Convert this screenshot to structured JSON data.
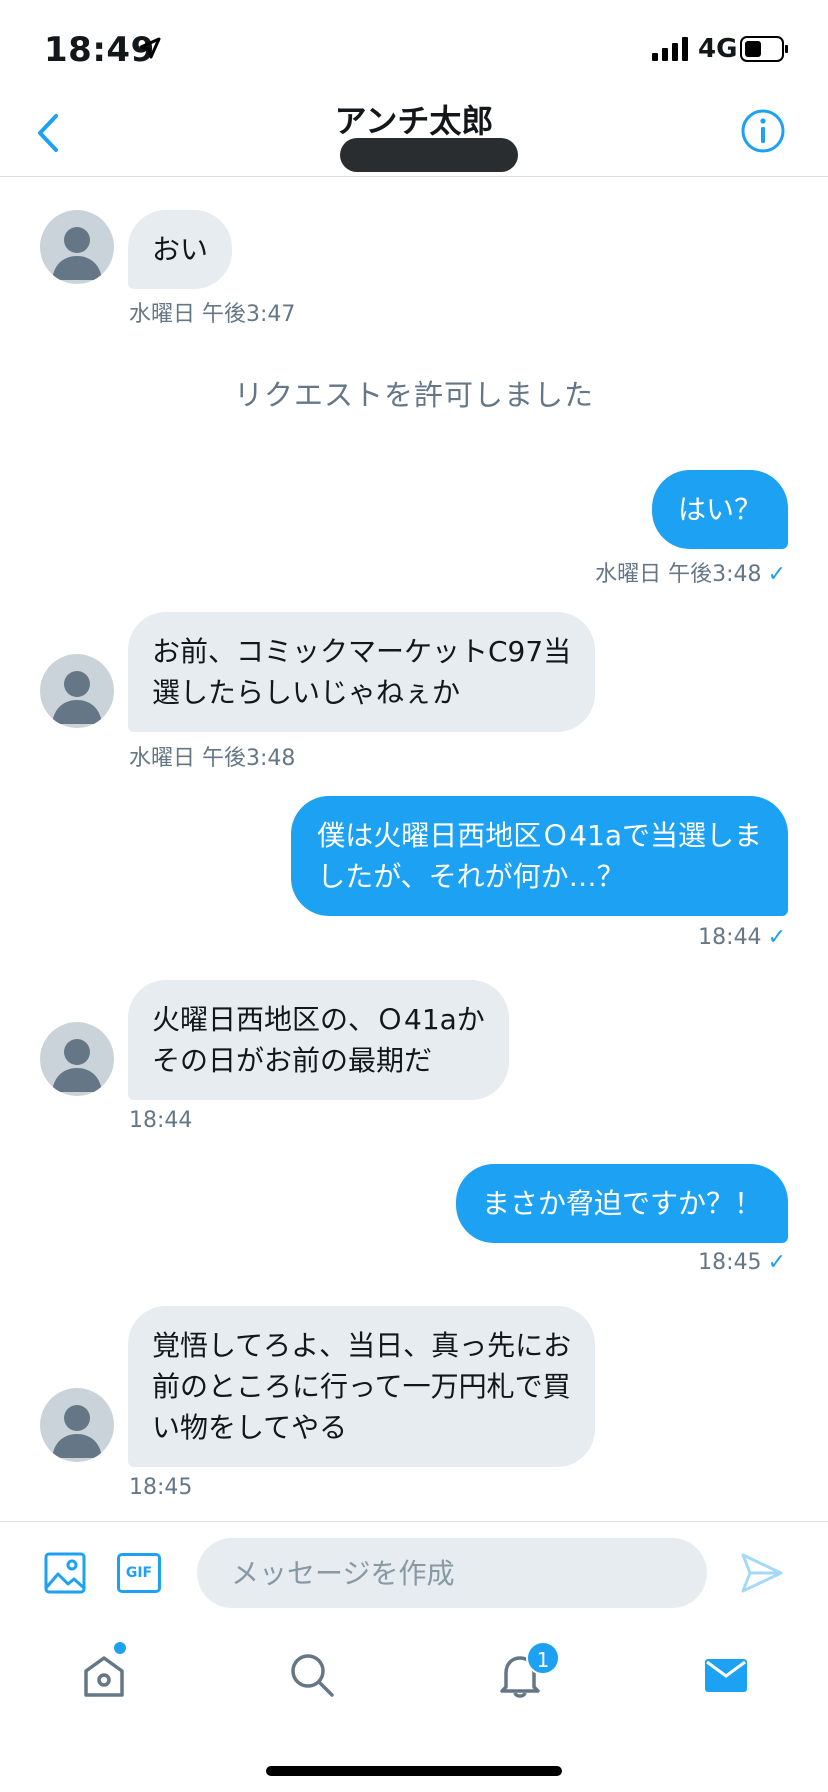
{
  "status_bar": {
    "time": "18:49",
    "network": "4G"
  },
  "header": {
    "title": "アンチ太郎"
  },
  "system_note": "リクエストを許可しました",
  "messages": [
    {
      "direction": "in",
      "text": "おい",
      "time": "水曜日 午後3:47"
    },
    {
      "direction": "out",
      "text": "はい？",
      "time": "水曜日 午後3:48",
      "read_mark": "✓"
    },
    {
      "direction": "in",
      "text": "お前、コミックマーケットC97当\n選したらしいじゃねぇか",
      "time": "水曜日 午後3:48"
    },
    {
      "direction": "out",
      "text": "僕は火曜日西地区Ｏ41aで当選しま\nしたが、それが何か…？",
      "time": "18:44",
      "read_mark": "✓"
    },
    {
      "direction": "in",
      "text": "火曜日西地区の、Ｏ41aか\nその日がお前の最期だ",
      "time": "18:44"
    },
    {
      "direction": "out",
      "text": "まさか脅迫ですか？！",
      "time": "18:45",
      "read_mark": "✓"
    },
    {
      "direction": "in",
      "text": "覚悟してろよ、当日、真っ先にお\n前のところに行って一万円札で買\nい物をしてやる",
      "time": "18:45"
    }
  ],
  "composer": {
    "gif_label": "GIF",
    "placeholder": "メッセージを作成"
  },
  "tab_bar": {
    "notifications_badge": "1"
  },
  "colors": {
    "accent": "#1da1f2",
    "incoming_bubble": "#e6ecf0",
    "secondary_text": "#657786"
  }
}
